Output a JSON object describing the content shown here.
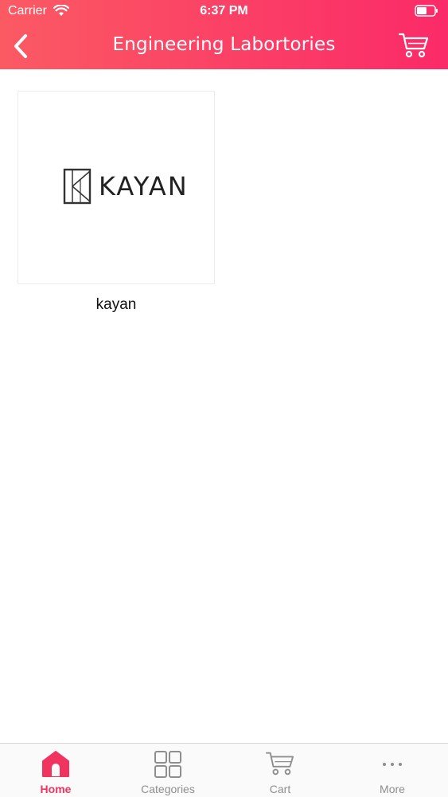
{
  "status": {
    "carrier": "Carrier",
    "time": "6:37 PM"
  },
  "header": {
    "title": "Engineering Labortories"
  },
  "items": [
    {
      "label": "kayan",
      "logo_text": "KAYAN"
    }
  ],
  "tabs": [
    {
      "label": "Home",
      "icon": "home-icon",
      "active": true
    },
    {
      "label": "Categories",
      "icon": "grid-icon",
      "active": false
    },
    {
      "label": "Cart",
      "icon": "cart-icon",
      "active": false
    },
    {
      "label": "More",
      "icon": "more-icon",
      "active": false
    }
  ],
  "colors": {
    "accent": "#f0335f",
    "header_start": "#fb5a63",
    "header_end": "#fb2a68",
    "tab_inactive": "#8e8e8e"
  }
}
